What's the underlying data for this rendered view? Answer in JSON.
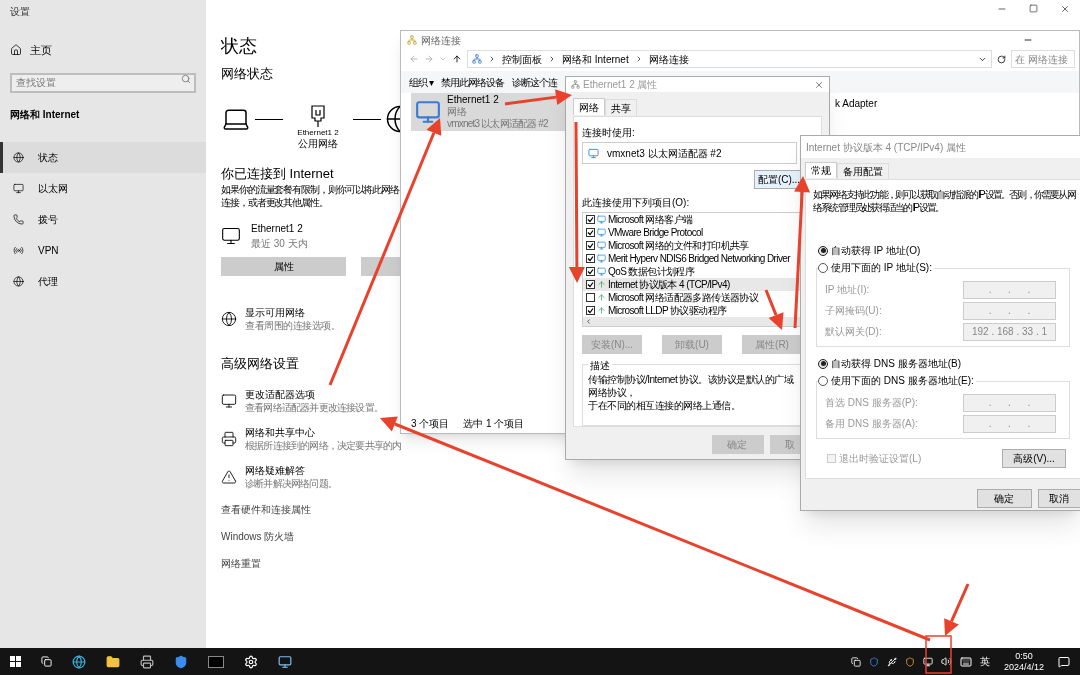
{
  "settings": {
    "title": "设置",
    "home": "主页",
    "search": {
      "placeholder": "查找设置"
    },
    "section": "网络和 Internet",
    "nav": [
      {
        "label": "状态",
        "selected": true
      },
      {
        "label": "以太网",
        "selected": false
      },
      {
        "label": "拨号",
        "selected": false
      },
      {
        "label": "VPN",
        "selected": false
      },
      {
        "label": "代理",
        "selected": false
      }
    ],
    "heading": "状态",
    "subheading": "网络状态",
    "diagram": {
      "adapter": "Ethernet1 2",
      "network": "公用网络"
    },
    "connected": "你已连接到 Internet",
    "connected_text": [
      "如果你的流量套餐有限制，则你可以将此网络",
      "连接，或者更改其他属性。"
    ],
    "adapter": {
      "name": "Ethernet1 2",
      "detail": "最近 30 天内"
    },
    "properties_button": "属性",
    "show_networks": {
      "title": "显示可用网络",
      "text": "查看周围的连接选项。"
    },
    "advanced_heading": "高级网络设置",
    "advanced": [
      {
        "title": "更改适配器选项",
        "text": "查看网络适配器并更改连接设置。"
      },
      {
        "title": "网络和共享中心",
        "text": "根据所连接到的网络，决定要共享的内"
      },
      {
        "title": "网络疑难解答",
        "text": "诊断并解决网络问题。"
      }
    ],
    "links": [
      "查看硬件和连接属性",
      "Windows 防火墙",
      "网络重置"
    ]
  },
  "explorer": {
    "title": "网络连接",
    "breadcrumb": [
      "控制面板",
      "网络和 Internet",
      "网络连接"
    ],
    "search": {
      "placeholder": "在 网络连接"
    },
    "toolbar": [
      "组织 ▾",
      "禁用此网络设备",
      "诊断这个连"
    ],
    "item": {
      "name": "Ethernet1 2",
      "status": "网络",
      "device": "vmxnet3 以太网适配器 #2",
      "selected": true
    },
    "other_item": "k Adapter",
    "status": [
      "3 个项目",
      "选中 1 个项目"
    ]
  },
  "adapter_dialog": {
    "title": "Ethernet1 2 属性",
    "tabs": [
      {
        "label": "网络",
        "selected": true
      },
      {
        "label": "共享",
        "selected": false
      }
    ],
    "connect_using_label": "连接时使用:",
    "device": "vmxnet3 以太网适配器 #2",
    "configure_button": "配置(C)...",
    "items_label": "此连接使用下列项目(O):",
    "items": [
      {
        "label": "Microsoft 网络客户端",
        "checked": true,
        "selected": false,
        "kind": "client"
      },
      {
        "label": "VMware Bridge Protocol",
        "checked": true,
        "selected": false,
        "kind": "client"
      },
      {
        "label": "Microsoft 网络的文件和打印机共享",
        "checked": true,
        "selected": false,
        "kind": "client"
      },
      {
        "label": "Merit Hyperv NDIS6 Bridged Networking Driver",
        "checked": true,
        "selected": false,
        "kind": "client"
      },
      {
        "label": "QoS 数据包计划程序",
        "checked": true,
        "selected": false,
        "kind": "client"
      },
      {
        "label": "Internet 协议版本 4 (TCP/IPv4)",
        "checked": true,
        "selected": true,
        "kind": "protocol"
      },
      {
        "label": "Microsoft 网络适配器多路传送器协议",
        "checked": false,
        "selected": false,
        "kind": "protocol"
      },
      {
        "label": "Microsoft LLDP 协议驱动程序",
        "checked": true,
        "selected": false,
        "kind": "protocol"
      }
    ],
    "buttons": [
      {
        "label": "安装(N)...",
        "disabled": true
      },
      {
        "label": "卸载(U)",
        "disabled": true
      },
      {
        "label": "属性(R)",
        "disabled": true
      }
    ],
    "description_label": "描述",
    "description": [
      "传输控制协议/Internet 协议。该协议是默认的广域网络协议，",
      "于在不同的相互连接的网络上通信。"
    ],
    "footer": [
      {
        "label": "确定",
        "disabled": true
      },
      {
        "label": "取",
        "disabled": true
      }
    ]
  },
  "ipv4_dialog": {
    "title": "Internet 协议版本 4 (TCP/IPv4) 属性",
    "tabs": [
      {
        "label": "常规",
        "selected": true
      },
      {
        "label": "备用配置",
        "selected": false
      }
    ],
    "intro": [
      "如果网络支持此功能，则可以获取自动指派的 IP 设置。否则，你需要从网",
      "络系统管理员处获得适当的 IP 设置。"
    ],
    "ip_radios": [
      {
        "label": "自动获得 IP 地址(O)",
        "selected": true
      },
      {
        "label": "使用下面的 IP 地址(S):",
        "selected": false
      }
    ],
    "ip_fields": [
      {
        "label": "IP 地址(I):",
        "value": ".      .      ."
      },
      {
        "label": "子网掩码(U):",
        "value": ".      .      ."
      },
      {
        "label": "默认网关(D):",
        "value": "192 . 168 . 33 . 1"
      }
    ],
    "dns_radios": [
      {
        "label": "自动获得 DNS 服务器地址(B)",
        "selected": true
      },
      {
        "label": "使用下面的 DNS 服务器地址(E):",
        "selected": false
      }
    ],
    "dns_fields": [
      {
        "label": "首选 DNS 服务器(P):",
        "value": ".      .      ."
      },
      {
        "label": "备用 DNS 服务器(A):",
        "value": ".      .      ."
      }
    ],
    "validate": {
      "label": "退出时验证设置(L)",
      "checked": false,
      "disabled": true
    },
    "advanced_button": "高级(V)...",
    "ok": "确定",
    "cancel": "取消"
  },
  "taskbar": {
    "language": "英",
    "time": "0:50",
    "date": "2024/4/12"
  }
}
